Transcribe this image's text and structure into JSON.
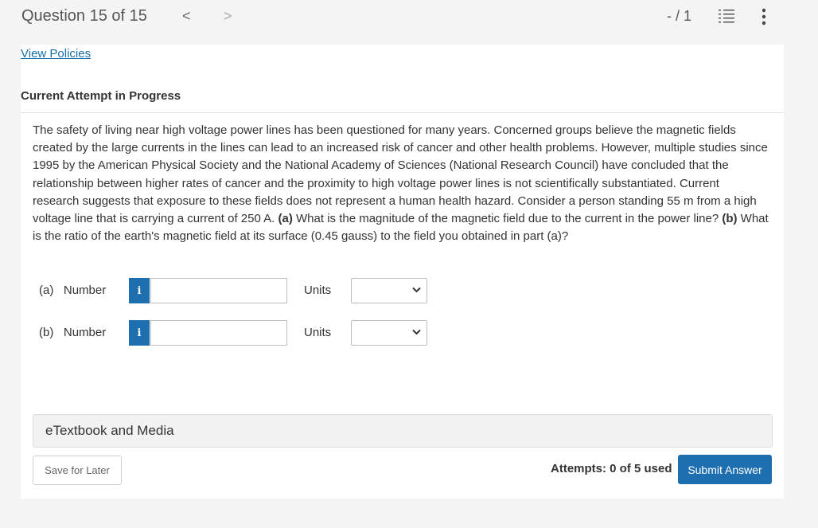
{
  "header": {
    "question_title": "Question 15 of 15",
    "prev_glyph": "<",
    "next_glyph": ">",
    "score": "- / 1",
    "icons": [
      "list-icon",
      "more-vertical-icon"
    ]
  },
  "policies": {
    "link_label": "View Policies"
  },
  "attempt": {
    "heading": "Current Attempt in Progress"
  },
  "question": {
    "text_1": "The safety of living near high voltage power lines has been questioned for many years. Concerned groups believe the magnetic fields created by the large currents in the lines can lead to an increased risk of cancer and other health problems. However, multiple studies since 1995 by the American Physical Society and the National Academy of Sciences (National Research Council) have concluded that the relationship between higher rates of cancer and the proximity to high voltage power lines is not scientifically substantiated. Current research suggests that exposure to these fields does not represent a human health hazard. Consider a person standing 55 m from a high voltage line that is carrying a current of 250 A. ",
    "part_a_marker": "(a)",
    "text_2": " What is the magnitude of the magnetic field due to the current in the power line? ",
    "part_b_marker": "(b)",
    "text_3": " What is the ratio of the earth's magnetic field at its surface (0.45 gauss) to the field you obtained in part (a)?"
  },
  "answers": [
    {
      "part": "(a)",
      "number_label": "Number",
      "info_glyph": "i",
      "value": "",
      "units_label": "Units",
      "units_value": ""
    },
    {
      "part": "(b)",
      "number_label": "Number",
      "info_glyph": "i",
      "value": "",
      "units_label": "Units",
      "units_value": ""
    }
  ],
  "etextbook": {
    "label": "eTextbook and Media"
  },
  "footer": {
    "save_label": "Save for Later",
    "attempts_text": "Attempts: 0 of 5 used",
    "submit_label": "Submit Answer"
  },
  "colors": {
    "accent": "#1e6fb0",
    "link": "#1a6ea8",
    "background": "#f4f4f4"
  }
}
